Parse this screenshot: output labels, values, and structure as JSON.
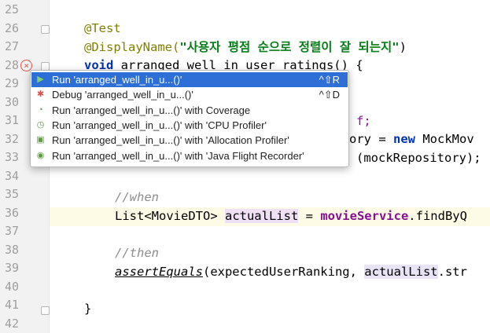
{
  "gutter": {
    "line_numbers": [
      "25",
      "26",
      "27",
      "28",
      "29",
      "30",
      "31",
      "32",
      "33",
      "34",
      "35",
      "36",
      "37",
      "38",
      "39",
      "40",
      "41",
      "42"
    ]
  },
  "code": {
    "l26": "@Test",
    "l27_anno": "@DisplayName(",
    "l27_str": "\"사용자 평점 순으로 정렬이 잘 되는지\"",
    "l27_close": ")",
    "l28_kw": "void",
    "l28_rest": " arranged_well_in_user_ratings() {",
    "l31_tail": "f;",
    "l32_a": "ory = ",
    "l32_kw": "new",
    "l32_b": " MockMov",
    "l33_tail": "(mockRepository);",
    "l35": "//when",
    "l36_a": "List<MovieDTO> ",
    "l36_var": "actualList",
    "l36_b": " = ",
    "l36_svc": "movieService",
    "l36_c": ".findByQ",
    "l38": "//then",
    "l39_call": "assertEquals",
    "l39_a": "(expectedUserRanking, ",
    "l39_var": "actualList",
    "l39_b": ".str",
    "l41": "}"
  },
  "popup": {
    "items": [
      {
        "icon": "run-icon",
        "glyph": "▶",
        "label": "Run 'arranged_well_in_u...()'",
        "shortcut": "^⇧R"
      },
      {
        "icon": "debug-icon",
        "glyph": "✱",
        "label": "Debug 'arranged_well_in_u...()'",
        "shortcut": "^⇧D"
      },
      {
        "icon": "coverage-icon",
        "glyph": "◔",
        "label": "Run 'arranged_well_in_u...()' with Coverage",
        "shortcut": ""
      },
      {
        "icon": "cpu-profiler-icon",
        "glyph": "◷",
        "label": "Run 'arranged_well_in_u...()' with 'CPU Profiler'",
        "shortcut": ""
      },
      {
        "icon": "allocation-profiler-icon",
        "glyph": "▣",
        "label": "Run 'arranged_well_in_u...()' with 'Allocation Profiler'",
        "shortcut": ""
      },
      {
        "icon": "flight-recorder-icon",
        "glyph": "◉",
        "label": "Run 'arranged_well_in_u...()' with 'Java Flight Recorder'",
        "shortcut": ""
      }
    ]
  },
  "colors": {
    "selection": "#2d6fd6",
    "error": "#e0534b",
    "annotation": "#808000",
    "string": "#067d17",
    "keyword": "#0033b3",
    "comment": "#8c8c8c"
  }
}
